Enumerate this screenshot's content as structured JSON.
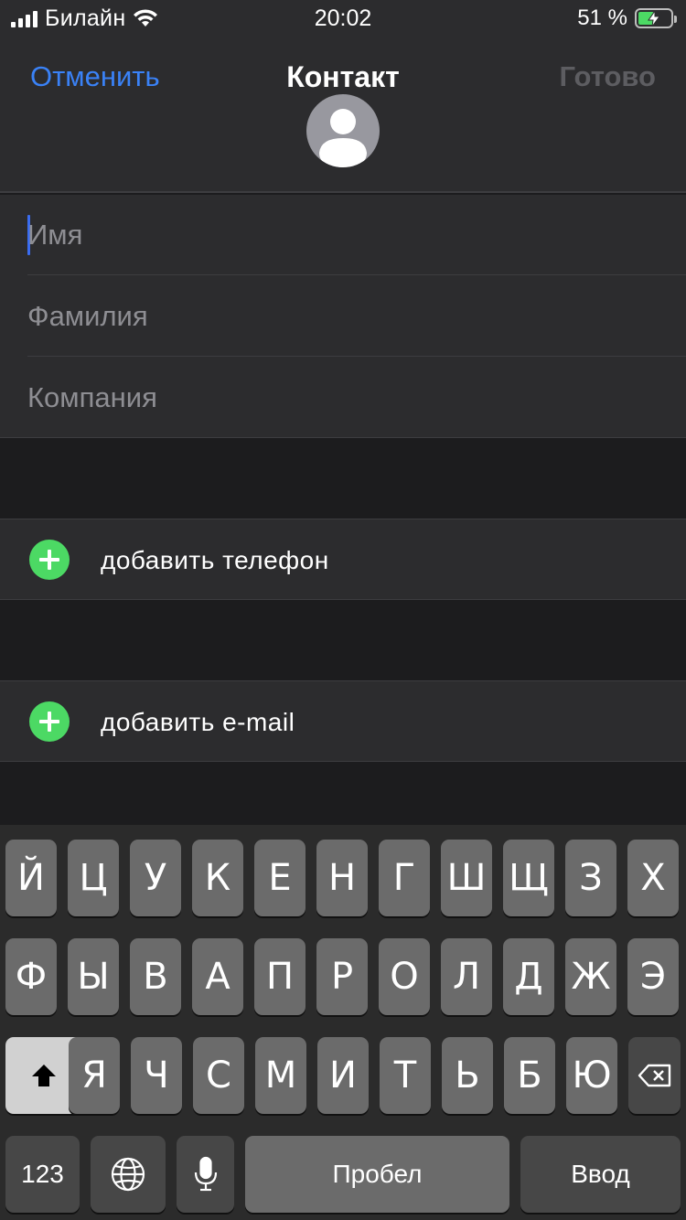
{
  "status_bar": {
    "carrier": "Билайн",
    "time": "20:02",
    "battery_percent": "51 %",
    "battery_level": 0.51,
    "icons": [
      "signal-icon",
      "wifi-icon",
      "battery-charging-icon"
    ]
  },
  "header": {
    "cancel_label": "Отменить",
    "title": "Контакт",
    "done_label": "Готово",
    "avatar_icon": "person-silhouette-icon"
  },
  "fields": {
    "first_name_placeholder": "Имя",
    "last_name_placeholder": "Фамилия",
    "company_placeholder": "Компания"
  },
  "actions": {
    "add_phone": "добавить телефон",
    "add_email": "добавить e-mail"
  },
  "keyboard": {
    "row1": [
      "Й",
      "Ц",
      "У",
      "К",
      "Е",
      "Н",
      "Г",
      "Ш",
      "Щ",
      "З",
      "Х"
    ],
    "row2": [
      "Ф",
      "Ы",
      "В",
      "А",
      "П",
      "Р",
      "О",
      "Л",
      "Д",
      "Ж",
      "Э"
    ],
    "row3": [
      "Я",
      "Ч",
      "С",
      "М",
      "И",
      "Т",
      "Ь",
      "Б",
      "Ю"
    ],
    "numbers_label": "123",
    "space_label": "Пробел",
    "return_label": "Ввод",
    "icons": [
      "shift-icon",
      "delete-icon",
      "globe-icon",
      "microphone-icon"
    ]
  },
  "colors": {
    "accent": "#3a82f7",
    "add_button": "#4cd964",
    "background": "#1c1c1e",
    "cell": "#2c2c2e",
    "done_disabled": "#5d5d61"
  }
}
